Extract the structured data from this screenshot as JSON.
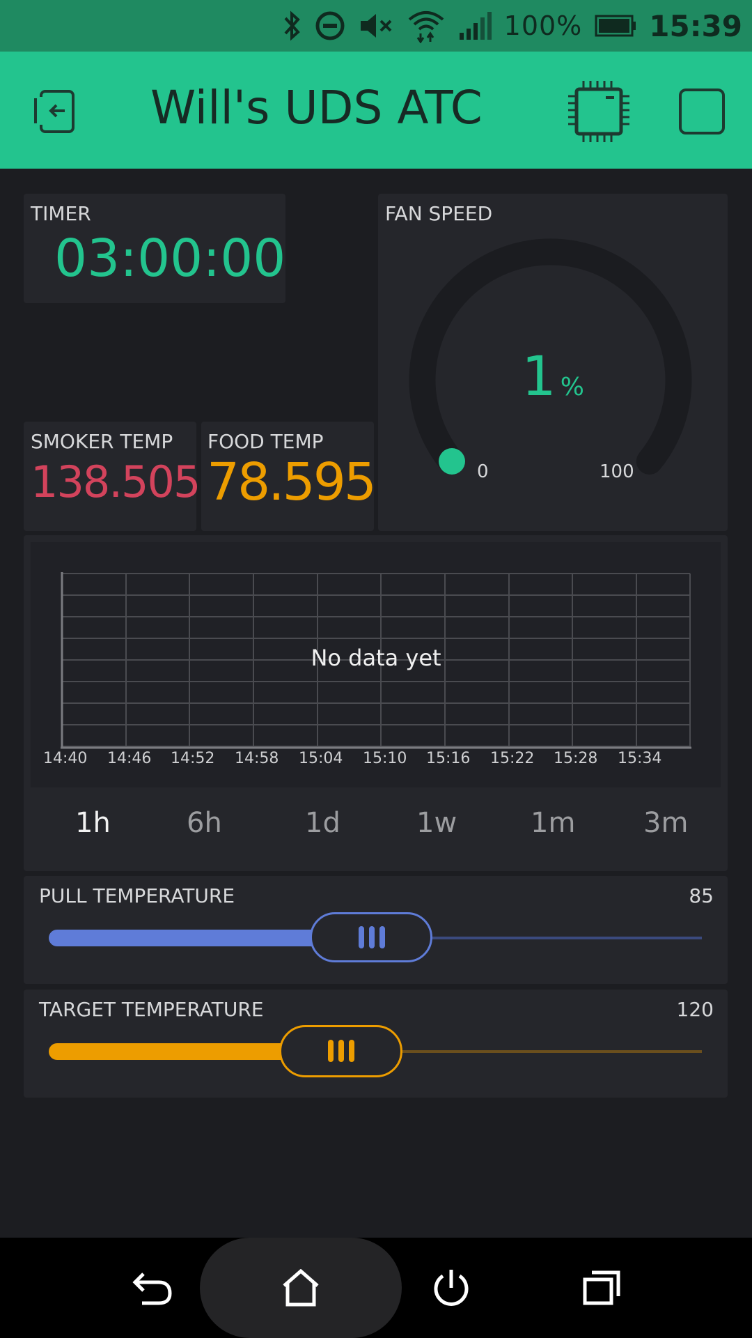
{
  "status_bar": {
    "battery": "100%",
    "time": "15:39",
    "icons": [
      "bluetooth-icon",
      "do-not-disturb-icon",
      "mute-icon",
      "wifi-icon",
      "signal-icon",
      "battery-icon"
    ]
  },
  "app_bar": {
    "title": "Will's UDS ATC",
    "icons": [
      "back-icon",
      "device-chip-icon",
      "stop-icon"
    ]
  },
  "timer": {
    "label": "TIMER",
    "value": "03:00:00",
    "color": "#23c48e"
  },
  "fan_speed": {
    "label": "FAN SPEED",
    "value": "1",
    "unit": "%",
    "min": "0",
    "max": "100",
    "level_fraction": 0.01,
    "color": "#23c48e"
  },
  "smoker_temp": {
    "label": "SMOKER TEMP",
    "value": "138.505",
    "color": "#d3435c"
  },
  "food_temp": {
    "label": "FOOD TEMP",
    "value": "78.595",
    "color": "#ed9d00"
  },
  "chart": {
    "message": "No data yet",
    "time_labels": [
      "14:40",
      "14:46",
      "14:52",
      "14:58",
      "15:04",
      "15:10",
      "15:16",
      "15:22",
      "15:28",
      "15:34"
    ],
    "ranges": [
      "1h",
      "6h",
      "1d",
      "1w",
      "1m",
      "3m"
    ],
    "active_range": "1h"
  },
  "pull_temperature": {
    "label": "PULL TEMPERATURE",
    "value": "85",
    "fraction": 0.49,
    "color": "#5f7cd8"
  },
  "target_temperature": {
    "label": "TARGET TEMPERATURE",
    "value": "120",
    "fraction": 0.44,
    "color": "#ed9d00"
  },
  "nav_bar": {
    "icons": [
      "back-arrow-icon",
      "home-icon",
      "power-icon",
      "recent-apps-icon"
    ]
  }
}
